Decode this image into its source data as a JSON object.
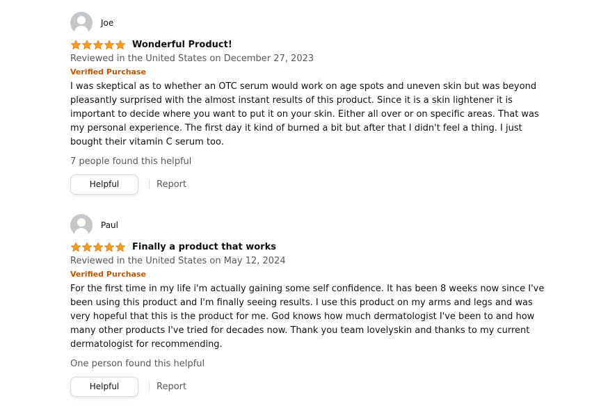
{
  "colors": {
    "star": "#f79e1b",
    "verified": "#c45500",
    "secondary_text": "#565959",
    "primary_text": "#0f1111"
  },
  "reviews": [
    {
      "reviewer": "Joe",
      "avatar_icon": "default-user-avatar-icon",
      "rating": 5,
      "title": "Wonderful Product!",
      "date": "Reviewed in the United States on December 27, 2023",
      "badge": "Verified Purchase",
      "body": "I was skeptical as to whether an OTC serum would work on age spots and uneven skin but was beyond pleasantly surprised with the almost instant results of this product. Since it is a skin lightener it is important to decide where you want to put it on your skin. Either all over or on specific areas. That was my personal experience. The first day it kind of burned a bit but after that I didn't feel a thing. I just bought their vitamin C serum too.",
      "helpful_count": "7 people found this helpful",
      "helpful_label": "Helpful",
      "report_label": "Report"
    },
    {
      "reviewer": "Paul",
      "avatar_icon": "default-user-avatar-icon",
      "rating": 5,
      "title": "Finally a product that works",
      "date": "Reviewed in the United States on May 12, 2024",
      "badge": "Verified Purchase",
      "body": "For the first time in my life i'm actually gaining some self confidence. It has been 8 weeks now since I've been using this product and I'm finally seeing results. I use this product on my arms and legs and was very hopeful that this is the product for me. God knows how much dermatologist I've been to and how many other products I've tried for decades now. Thank you team lovelyskin and thanks to my current dermatologist for recommending.",
      "helpful_count": "One person found this helpful",
      "helpful_label": "Helpful",
      "report_label": "Report"
    }
  ]
}
